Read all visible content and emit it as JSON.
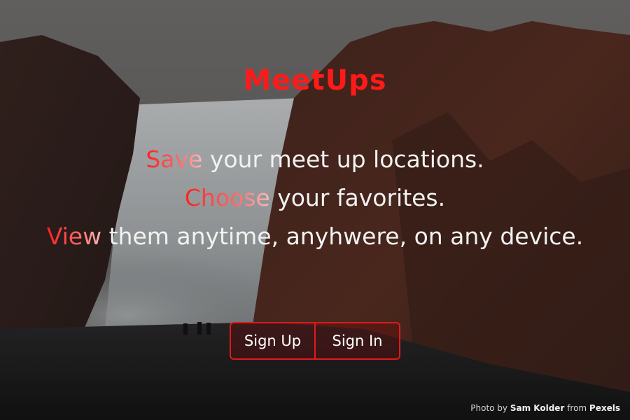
{
  "brand": {
    "title": "MeetUps",
    "color": "#ff1a1a"
  },
  "tagline": [
    {
      "highlight": "Save",
      "rest": " your meet up locations."
    },
    {
      "highlight": "Choose",
      "rest": " your favorites."
    },
    {
      "highlight": "View",
      "rest": " them anytime, anyhwere, on any device."
    }
  ],
  "buttons": {
    "sign_up": "Sign Up",
    "sign_in": "Sign In",
    "border_color": "#e01a1a"
  },
  "credit": {
    "prefix": "Photo by ",
    "author": "Sam Kolder",
    "middle": " from ",
    "source": "Pexels"
  },
  "background": {
    "subject": "waterfall-cliff-photo"
  }
}
